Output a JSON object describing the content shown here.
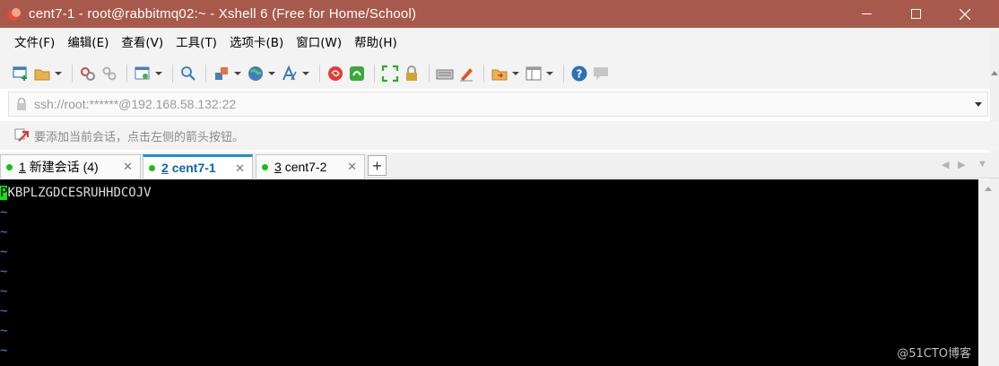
{
  "window": {
    "title": "cent7-1 - root@rabbitmq02:~ - Xshell 6 (Free for Home/School)"
  },
  "menu": [
    {
      "label": "文件(F)",
      "name": "menu-file"
    },
    {
      "label": "编辑(E)",
      "name": "menu-edit"
    },
    {
      "label": "查看(V)",
      "name": "menu-view"
    },
    {
      "label": "工具(T)",
      "name": "menu-tools"
    },
    {
      "label": "选项卡(B)",
      "name": "menu-tabs"
    },
    {
      "label": "窗口(W)",
      "name": "menu-window"
    },
    {
      "label": "帮助(H)",
      "name": "menu-help"
    }
  ],
  "address": {
    "value": "ssh://root:******@192.168.58.132:22"
  },
  "hint": {
    "text": "要添加当前会话，点击左侧的箭头按钮。"
  },
  "tabs": [
    {
      "number": "1",
      "label": "新建会话 (4)",
      "active": false
    },
    {
      "number": "2",
      "label": "cent7-1",
      "active": true
    },
    {
      "number": "3",
      "label": "cent7-2",
      "active": false
    }
  ],
  "terminal": {
    "cursor_char": "P",
    "first_line_rest": "KBPLZGDCESRUHHDCOJV",
    "tilde": "~",
    "tilde_count": 8
  },
  "watermark": "@51CTO博客",
  "colors": {
    "titlebar": "#a7594b",
    "active_tab_accent": "#1e90d6",
    "status_dot": "#17c017",
    "cursor": "#18e018",
    "tilde": "#3a8ccf"
  }
}
